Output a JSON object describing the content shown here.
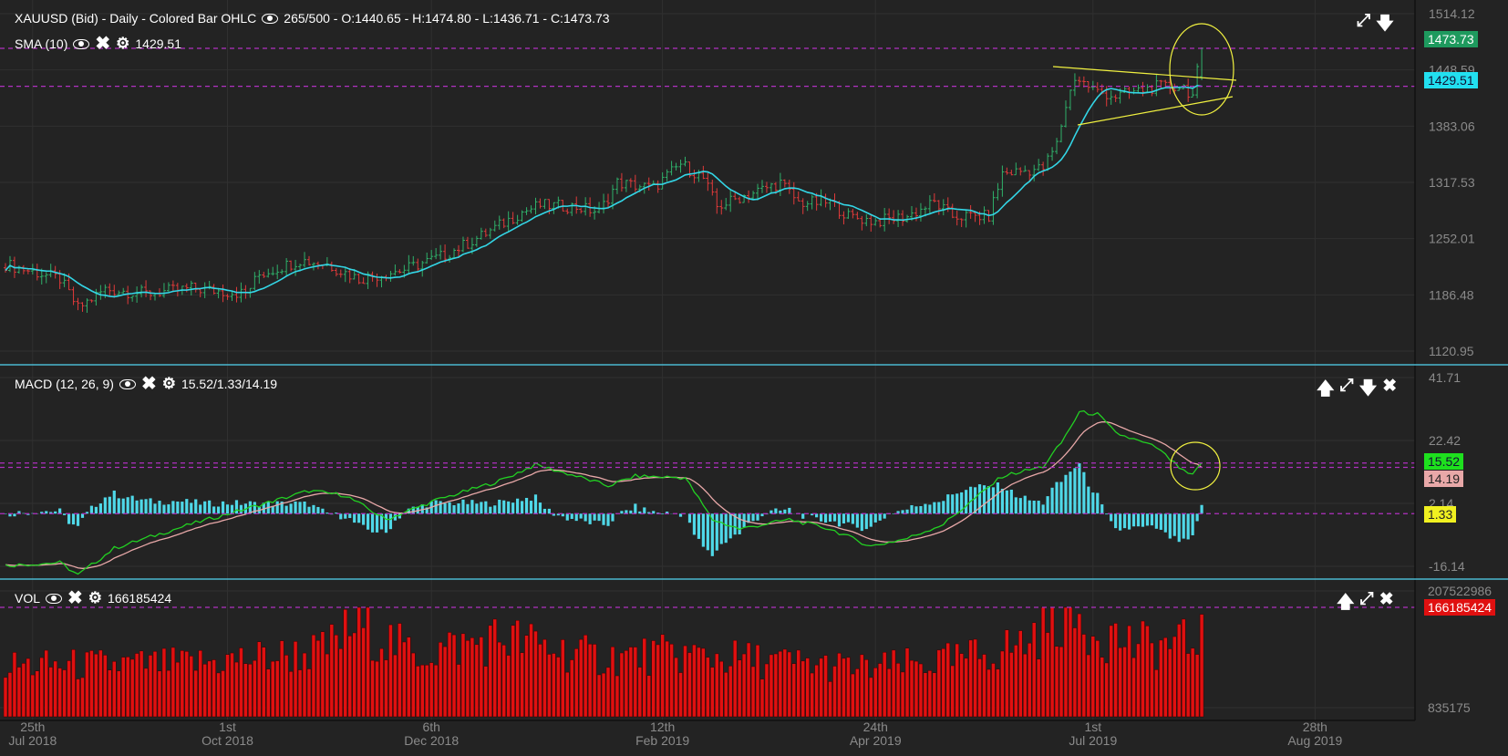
{
  "header": {
    "title": "XAUUSD (Bid) - Daily - Colored Bar OHLC",
    "ohlc": "265/500 - O:1440.65 - H:1474.80 - L:1436.71 - C:1473.73"
  },
  "sma": {
    "label": "SMA (10)",
    "value": "1429.51"
  },
  "macd": {
    "label": "MACD (12, 26, 9)",
    "value": "15.52/1.33/14.19"
  },
  "vol": {
    "label": "VOL",
    "value": "166185424"
  },
  "icons": {
    "eye": "eye-icon",
    "close": "close-icon",
    "settings": "gear-icon",
    "up": "arrow-up-icon",
    "down": "arrow-down-icon",
    "expand": "expand-icon"
  },
  "colors": {
    "up": "#2fb06a",
    "down": "#e03a3a",
    "sma": "#33d6e6",
    "macd": "#22d022",
    "signal": "#e8a8a8",
    "hist": "#4fd8e8",
    "volume": "#e01010",
    "dash": "#b030c0",
    "annotation": "#f0f040",
    "separator": "#4ab8d0"
  },
  "chart_data": [
    {
      "type": "ohlc",
      "title": "XAUUSD (Bid) - Daily",
      "bars": 265,
      "yticks": [
        "1514.12",
        "1448.59",
        "1383.06",
        "1317.53",
        "1252.01",
        "1186.48",
        "1120.95"
      ],
      "ylim": [
        1120.95,
        1514.12
      ],
      "close_anchors": [
        [
          0,
          1222
        ],
        [
          12,
          1205
        ],
        [
          16,
          1171
        ],
        [
          22,
          1193
        ],
        [
          31,
          1188
        ],
        [
          41,
          1194
        ],
        [
          53,
          1188
        ],
        [
          56,
          1210
        ],
        [
          65,
          1227
        ],
        [
          71,
          1222
        ],
        [
          78,
          1205
        ],
        [
          88,
          1216
        ],
        [
          97,
          1233
        ],
        [
          105,
          1255
        ],
        [
          114,
          1283
        ],
        [
          118,
          1291
        ],
        [
          126,
          1289
        ],
        [
          131,
          1283
        ],
        [
          135,
          1317
        ],
        [
          143,
          1311
        ],
        [
          149,
          1339
        ],
        [
          154,
          1322
        ],
        [
          157,
          1289
        ],
        [
          162,
          1300
        ],
        [
          171,
          1317
        ],
        [
          175,
          1294
        ],
        [
          182,
          1294
        ],
        [
          186,
          1278
        ],
        [
          192,
          1272
        ],
        [
          199,
          1278
        ],
        [
          205,
          1294
        ],
        [
          209,
          1278
        ],
        [
          217,
          1278
        ],
        [
          220,
          1328
        ],
        [
          229,
          1334
        ],
        [
          232,
          1362
        ],
        [
          234,
          1407
        ],
        [
          236,
          1440
        ],
        [
          241,
          1423
        ],
        [
          245,
          1418
        ],
        [
          254,
          1429
        ],
        [
          260,
          1429
        ],
        [
          262,
          1418
        ],
        [
          264,
          1473.73
        ]
      ],
      "last": {
        "open": 1440.65,
        "high": 1474.8,
        "low": 1436.71,
        "close": 1473.73
      },
      "sma_period": 10,
      "sma_last": 1429.51,
      "xticks": [
        {
          "day": "25th",
          "month": "Jul 2018",
          "bar": 6
        },
        {
          "day": "1st",
          "month": "Oct 2018",
          "bar": 49
        },
        {
          "day": "6th",
          "month": "Dec 2018",
          "bar": 94
        },
        {
          "day": "12th",
          "month": "Feb 2019",
          "bar": 145
        },
        {
          "day": "24th",
          "month": "Apr 2019",
          "bar": 192
        },
        {
          "day": "1st",
          "month": "Jul 2019",
          "bar": 240
        },
        {
          "day": "28th",
          "month": "Aug 2019",
          "bar": 289
        }
      ],
      "current_labels": [
        "1473.73",
        "1429.51"
      ]
    },
    {
      "type": "line",
      "title": "MACD (12, 26, 9)",
      "yticks": [
        "41.71",
        "22.42",
        "2.14",
        "-16.14"
      ],
      "ylim": [
        -16.14,
        41.71
      ],
      "macd_anchors": [
        [
          0,
          -15.9
        ],
        [
          12,
          -15
        ],
        [
          16,
          -18.8
        ],
        [
          24,
          -10.6
        ],
        [
          41,
          -3.2
        ],
        [
          56,
          2.6
        ],
        [
          67,
          7
        ],
        [
          75,
          5.6
        ],
        [
          84,
          -1.8
        ],
        [
          95,
          4.1
        ],
        [
          109,
          10
        ],
        [
          117,
          15
        ],
        [
          126,
          11.5
        ],
        [
          133,
          8.5
        ],
        [
          139,
          11.5
        ],
        [
          150,
          11
        ],
        [
          156,
          -1.8
        ],
        [
          162,
          -4.7
        ],
        [
          173,
          -1.8
        ],
        [
          182,
          -4.7
        ],
        [
          191,
          -10
        ],
        [
          199,
          -7.6
        ],
        [
          207,
          -3.2
        ],
        [
          220,
          11.5
        ],
        [
          229,
          14.4
        ],
        [
          233,
          21.7
        ],
        [
          237,
          31.1
        ],
        [
          241,
          30.5
        ],
        [
          245,
          24.7
        ],
        [
          254,
          20.3
        ],
        [
          260,
          12.9
        ],
        [
          262,
          11.7
        ],
        [
          264,
          15.52
        ]
      ],
      "current_labels": {
        "macd": "15.52",
        "signal": "14.19",
        "histogram": "1.33"
      }
    },
    {
      "type": "bar",
      "title": "VOL",
      "yticks": [
        "207522986",
        "835175"
      ],
      "ylim": [
        835175,
        207522986
      ],
      "volume_anchors": [
        [
          0,
          75000000
        ],
        [
          40,
          78000000
        ],
        [
          70,
          100000000
        ],
        [
          78,
          150000000
        ],
        [
          90,
          95000000
        ],
        [
          110,
          125000000
        ],
        [
          130,
          90000000
        ],
        [
          150,
          95000000
        ],
        [
          190,
          70000000
        ],
        [
          210,
          85000000
        ],
        [
          225,
          115000000
        ],
        [
          232,
          170000000
        ],
        [
          238,
          150000000
        ],
        [
          250,
          110000000
        ],
        [
          262,
          115000000
        ],
        [
          264,
          166185424
        ]
      ],
      "current_label": "166185424"
    }
  ]
}
